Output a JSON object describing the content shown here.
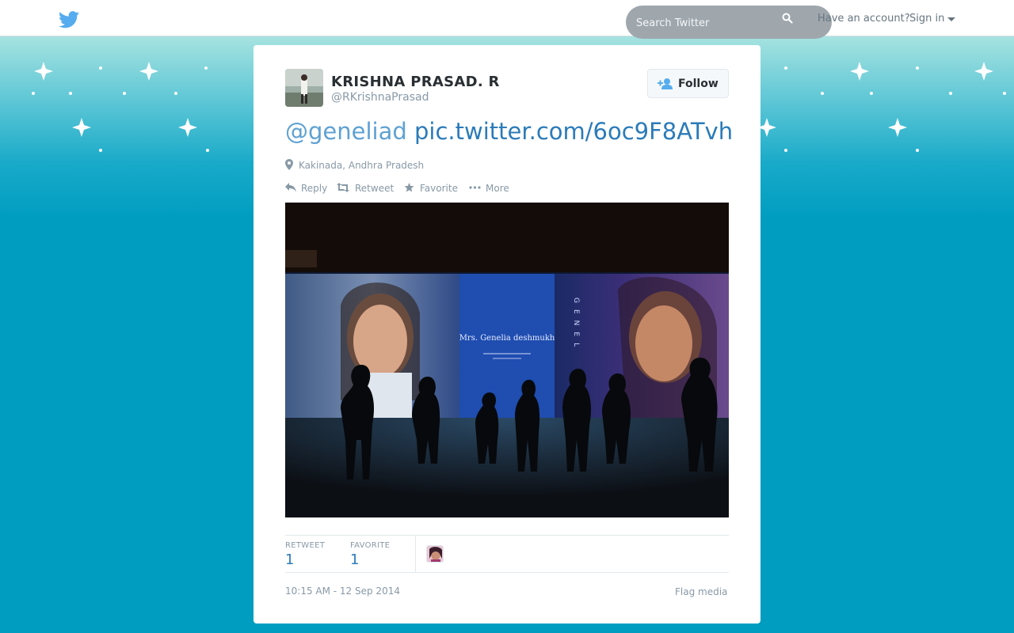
{
  "header": {
    "search_placeholder": "Search Twitter",
    "have_account": "Have an account?",
    "sign_in": "Sign in"
  },
  "tweet": {
    "fullname": "KRISHNA PRASAD. R",
    "username": "@RKrishnaPrasad",
    "follow_label": "Follow",
    "mention": "@geneliad",
    "link": "pic.twitter.com/6oc9F8ATvh",
    "location": "Kakinada, Andhra Pradesh",
    "actions": {
      "reply": "Reply",
      "retweet": "Retweet",
      "favorite": "Favorite",
      "more": "More"
    },
    "media": {
      "billboard_caption": "Mrs. Genelia deshmukh",
      "billboard_side_letters": "GENEL"
    },
    "stats": {
      "retweet_label": "RETWEET",
      "retweet_count": "1",
      "favorite_label": "FAVORITE",
      "favorite_count": "1"
    },
    "timestamp": "10:15 AM - 12 Sep 2014",
    "flag_media": "Flag media"
  },
  "colors": {
    "twitter_blue": "#55acee",
    "link_blue": "#2b7bb9",
    "background_teal": "#009dc0",
    "muted_text": "#8899a6"
  }
}
